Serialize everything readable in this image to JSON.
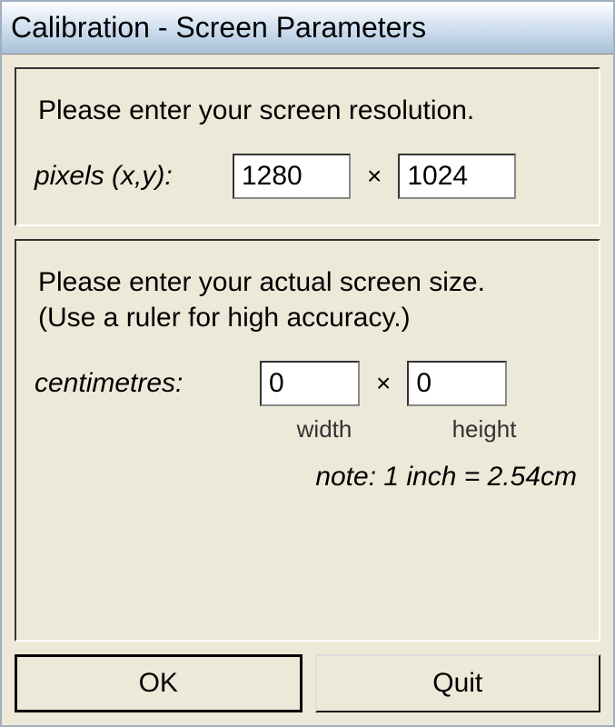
{
  "window": {
    "title": "Calibration - Screen Parameters"
  },
  "resolution": {
    "prompt": "Please enter your screen resolution.",
    "label": "pixels (x,y):",
    "x_value": "1280",
    "y_value": "1024",
    "separator": "×"
  },
  "screensize": {
    "prompt_line1": "Please enter your actual screen size.",
    "prompt_line2": "(Use a ruler for high accuracy.)",
    "label": "centimetres:",
    "width_value": "0",
    "height_value": "0",
    "separator": "×",
    "width_sublabel": "width",
    "height_sublabel": "height",
    "note": "note: 1 inch = 2.54cm"
  },
  "buttons": {
    "ok": "OK",
    "quit": "Quit"
  }
}
